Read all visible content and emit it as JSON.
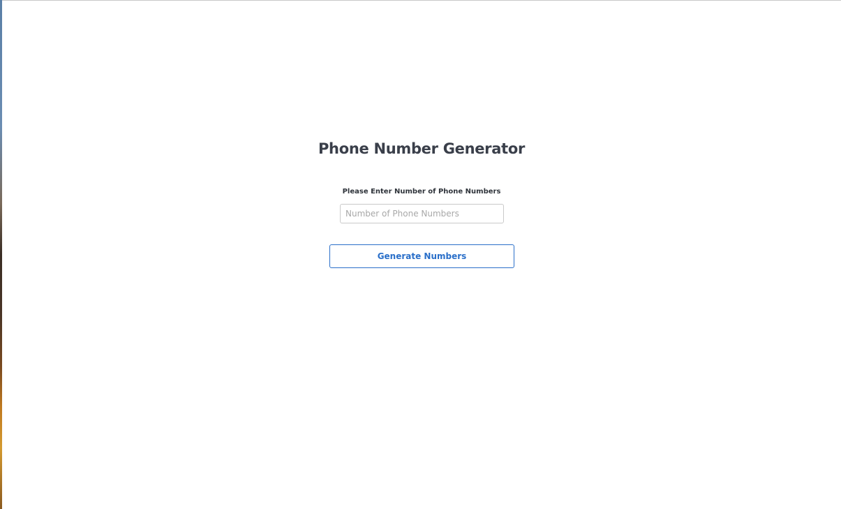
{
  "page": {
    "title": "Phone Number Generator"
  },
  "form": {
    "label": "Please Enter Number of Phone Numbers",
    "input": {
      "value": "",
      "placeholder": "Number of Phone Numbers"
    },
    "submit_label": "Generate Numbers"
  },
  "colors": {
    "accent": "#2a6fc9",
    "title": "#3a3f4a",
    "input_border": "#c9c9c9"
  }
}
